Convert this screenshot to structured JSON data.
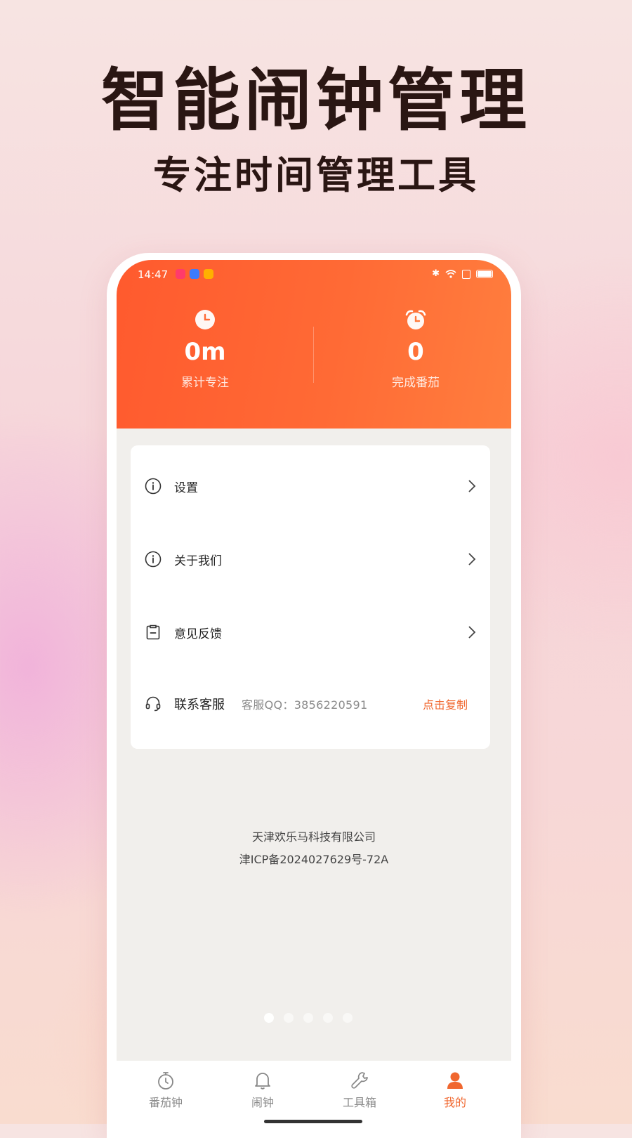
{
  "promo": {
    "title": "智能闹钟管理",
    "subtitle": "专注时间管理工具"
  },
  "status_bar": {
    "time": "14:47",
    "app_icon_colors": [
      "#ff3b6b",
      "#3c7bff",
      "#ffb000"
    ],
    "battery_level": 1.0
  },
  "stats": {
    "focus": {
      "icon": "clock-icon",
      "value": "0m",
      "label": "累计专注"
    },
    "pomodoro": {
      "icon": "alarm-clock-icon",
      "value": "0",
      "label": "完成番茄"
    }
  },
  "menu": {
    "items": [
      {
        "label": "设置",
        "icon": "info-circle-icon"
      },
      {
        "label": "关于我们",
        "icon": "info-circle-icon"
      },
      {
        "label": "意见反馈",
        "icon": "feedback-clipboard-icon"
      }
    ],
    "contact": {
      "label": "联系客服",
      "qq_text": "客服QQ：3856220591",
      "copy_label": "点击复制",
      "icon": "headset-icon"
    }
  },
  "footer": {
    "company": "天津欢乐马科技有限公司",
    "icp": "津ICP备2024027629号-72A"
  },
  "tabs": [
    {
      "label": "番茄钟",
      "icon": "stopwatch-icon",
      "active": false
    },
    {
      "label": "闹钟",
      "icon": "bell-icon",
      "active": false
    },
    {
      "label": "工具箱",
      "icon": "wrench-icon",
      "active": false
    },
    {
      "label": "我的",
      "icon": "user-icon",
      "active": true
    }
  ],
  "colors": {
    "accent": "#f0672f",
    "header_start": "#ff5a2e",
    "header_end": "#ff7e3e",
    "title_text": "#2a1613"
  },
  "page_indicator": {
    "count": 5,
    "active_index": 0
  }
}
